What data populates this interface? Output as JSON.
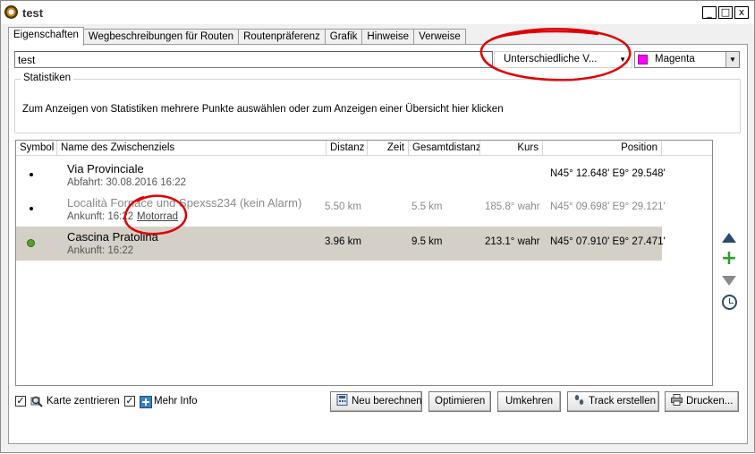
{
  "window": {
    "title": "test",
    "minimize": "_",
    "maximize": "□",
    "close": "x"
  },
  "tabs": [
    {
      "label": "Eigenschaften"
    },
    {
      "label": "Wegbeschreibungen für Routen"
    },
    {
      "label": "Routenpräferenz"
    },
    {
      "label": "Grafik"
    },
    {
      "label": "Hinweise"
    },
    {
      "label": "Verweise"
    }
  ],
  "name_field": {
    "value": "test"
  },
  "style_select": {
    "value": "Unterschiedliche V..."
  },
  "color_select": {
    "value": "Magenta",
    "swatch_color": "#ff00ff"
  },
  "stats": {
    "legend": "Statistiken",
    "text": "Zum Anzeigen von Statistiken mehrere Punkte auswählen oder zum Anzeigen einer Übersicht hier klicken"
  },
  "list": {
    "columns": [
      "Symbol",
      "Name des Zwischenziels",
      "Distanz",
      "Zeit",
      "Gesamtdistanz",
      "Kurs",
      "Position"
    ],
    "rows": [
      {
        "name": "Via Provinciale",
        "sub": "Abfahrt: 30.08.2016 16:22",
        "sub_link": "",
        "distance": "",
        "time": "",
        "total": "",
        "course": "",
        "position": "N45° 12.648' E9° 29.548'",
        "dimmed": false,
        "selected": false,
        "symbol": "black-dot"
      },
      {
        "name": "Località Fornace und Spexss234 (kein Alarm)",
        "sub": "Ankunft: 16:22",
        "sub_link": "Motorrad",
        "distance": "5.50 km",
        "time": "",
        "total": "5.5 km",
        "course": "185.8° wahr",
        "position": "N45° 09.698' E9° 29.121'",
        "dimmed": true,
        "selected": false,
        "symbol": "black-dot"
      },
      {
        "name": "Cascina Pratolina",
        "sub": "Ankunft: 16:22",
        "sub_link": "",
        "distance": "3.96 km",
        "time": "",
        "total": "9.5 km",
        "course": "213.1° wahr",
        "position": "N45° 07.910' E9° 27.471'",
        "dimmed": false,
        "selected": true,
        "symbol": "green-dot"
      }
    ]
  },
  "side_buttons": [
    "move-up",
    "add",
    "move-down",
    "time"
  ],
  "bottom": {
    "center_map": {
      "label": "Karte zentrieren",
      "checked": true
    },
    "more_info": {
      "label": "Mehr Info",
      "checked": true
    },
    "buttons": {
      "recalculate": "Neu berechnen",
      "optimize": "Optimieren",
      "reverse": "Umkehren",
      "create_track": "Track erstellen",
      "print": "Drucken..."
    }
  },
  "colors": {
    "selected_row": "#d4d0c8",
    "annotation": "#e00000"
  }
}
